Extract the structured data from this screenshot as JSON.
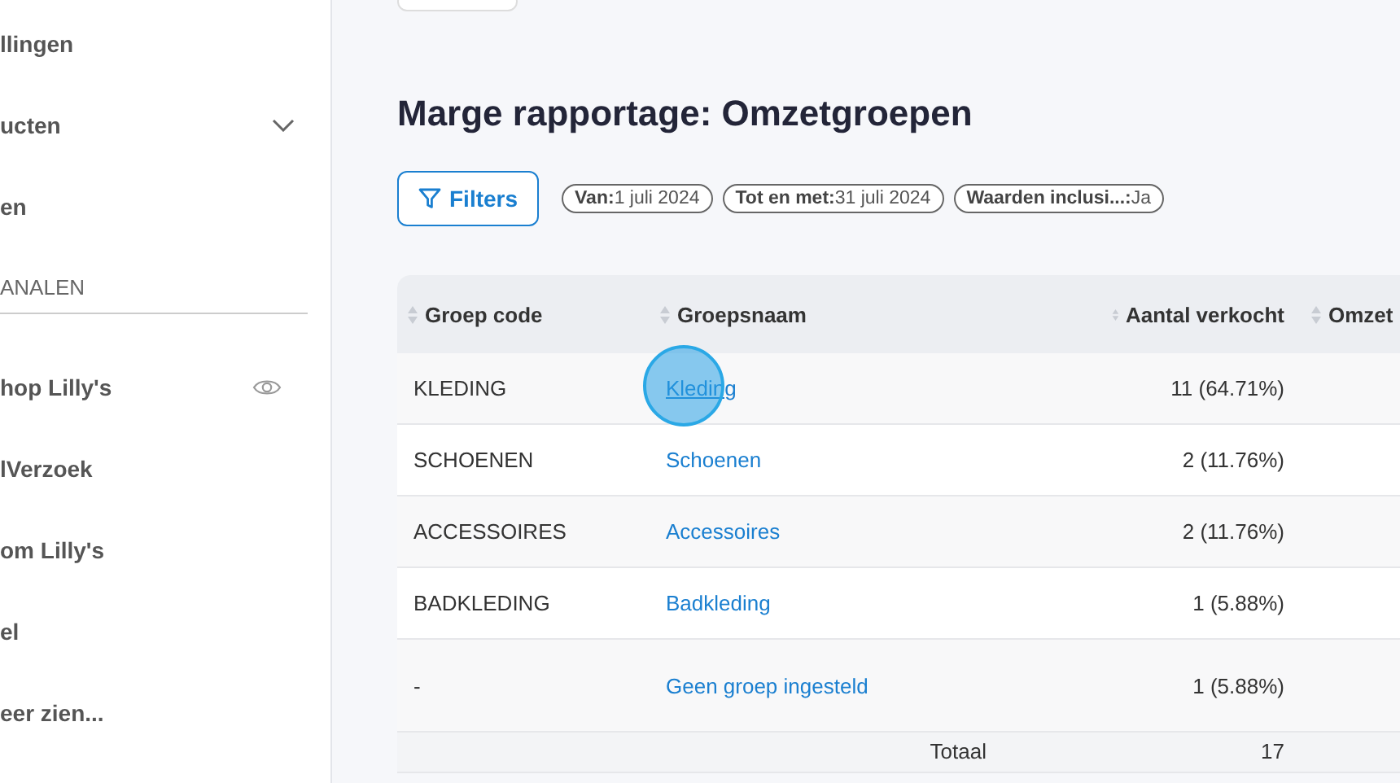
{
  "sidebar": {
    "items": [
      {
        "label": "llingen",
        "expandable": false,
        "visible_icon": false
      },
      {
        "label": "ucten",
        "expandable": true,
        "visible_icon": false
      },
      {
        "label": "en",
        "expandable": false,
        "visible_icon": false
      }
    ],
    "section": {
      "title": "ANALEN",
      "items": [
        {
          "label": "hop Lilly's",
          "visible_icon": true
        },
        {
          "label": "lVerzoek",
          "visible_icon": false
        },
        {
          "label": "om Lilly's",
          "visible_icon": false
        },
        {
          "label": "el",
          "visible_icon": false
        },
        {
          "label": "eer zien...",
          "visible_icon": false
        }
      ]
    }
  },
  "page": {
    "title": "Marge rapportage: Omzetgroepen",
    "filters_button": "Filters",
    "chips": [
      {
        "key": "Van:",
        "value": "1 juli 2024"
      },
      {
        "key": "Tot en met:",
        "value": "31 juli 2024"
      },
      {
        "key": "Waarden inclusi...:",
        "value": "Ja"
      }
    ]
  },
  "table": {
    "columns": [
      "Groep code",
      "Groepsnaam",
      "Aantal verkocht",
      "Omzet"
    ],
    "rows": [
      {
        "code": "KLEDING",
        "name": "Kleding",
        "sold": "11 (64.71%)",
        "hovered": true
      },
      {
        "code": "SCHOENEN",
        "name": "Schoenen",
        "sold": "2 (11.76%)",
        "hovered": false
      },
      {
        "code": "ACCESSOIRES",
        "name": "Accessoires",
        "sold": "2 (11.76%)",
        "hovered": false
      },
      {
        "code": "BADKLEDING",
        "name": "Badkleding",
        "sold": "1 (5.88%)",
        "hovered": false
      },
      {
        "code": "-",
        "name": "Geen groep ingesteld",
        "sold": "1 (5.88%)",
        "hovered": false
      }
    ],
    "total": {
      "label": "Totaal",
      "sold": "17"
    }
  }
}
